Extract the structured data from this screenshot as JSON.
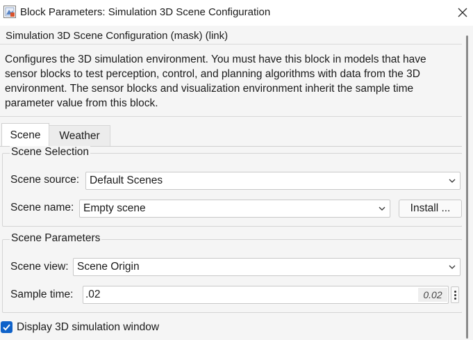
{
  "window": {
    "title": "Block Parameters: Simulation 3D Scene Configuration",
    "icons": {
      "app": "simulink-block-icon",
      "close": "close-icon"
    }
  },
  "header": {
    "mask_title": "Simulation 3D Scene Configuration (mask) (link)",
    "description": "Configures the 3D simulation environment. You must have this block in models that have sensor blocks to test perception, control, and planning algorithms with data from the 3D environment. The sensor blocks and visualization environment inherit the sample time parameter value from this block."
  },
  "tabs": [
    {
      "label": "Scene",
      "selected": true
    },
    {
      "label": "Weather",
      "selected": false
    }
  ],
  "scene_selection": {
    "title": "Scene Selection",
    "scene_source_label": "Scene source:",
    "scene_source_value": "Default Scenes",
    "scene_name_label": "Scene name:",
    "scene_name_value": "Empty scene",
    "install_button": "Install ..."
  },
  "scene_parameters": {
    "title": "Scene Parameters",
    "scene_view_label": "Scene view:",
    "scene_view_value": "Scene Origin",
    "sample_time_label": "Sample time:",
    "sample_time_value": ".02",
    "sample_time_evaluated": "0.02"
  },
  "display_window": {
    "label": "Display 3D simulation window",
    "checked": true
  },
  "colors": {
    "accent": "#0f62c9",
    "panel_bg": "#f5f5f5",
    "border": "#c8c8c8"
  }
}
